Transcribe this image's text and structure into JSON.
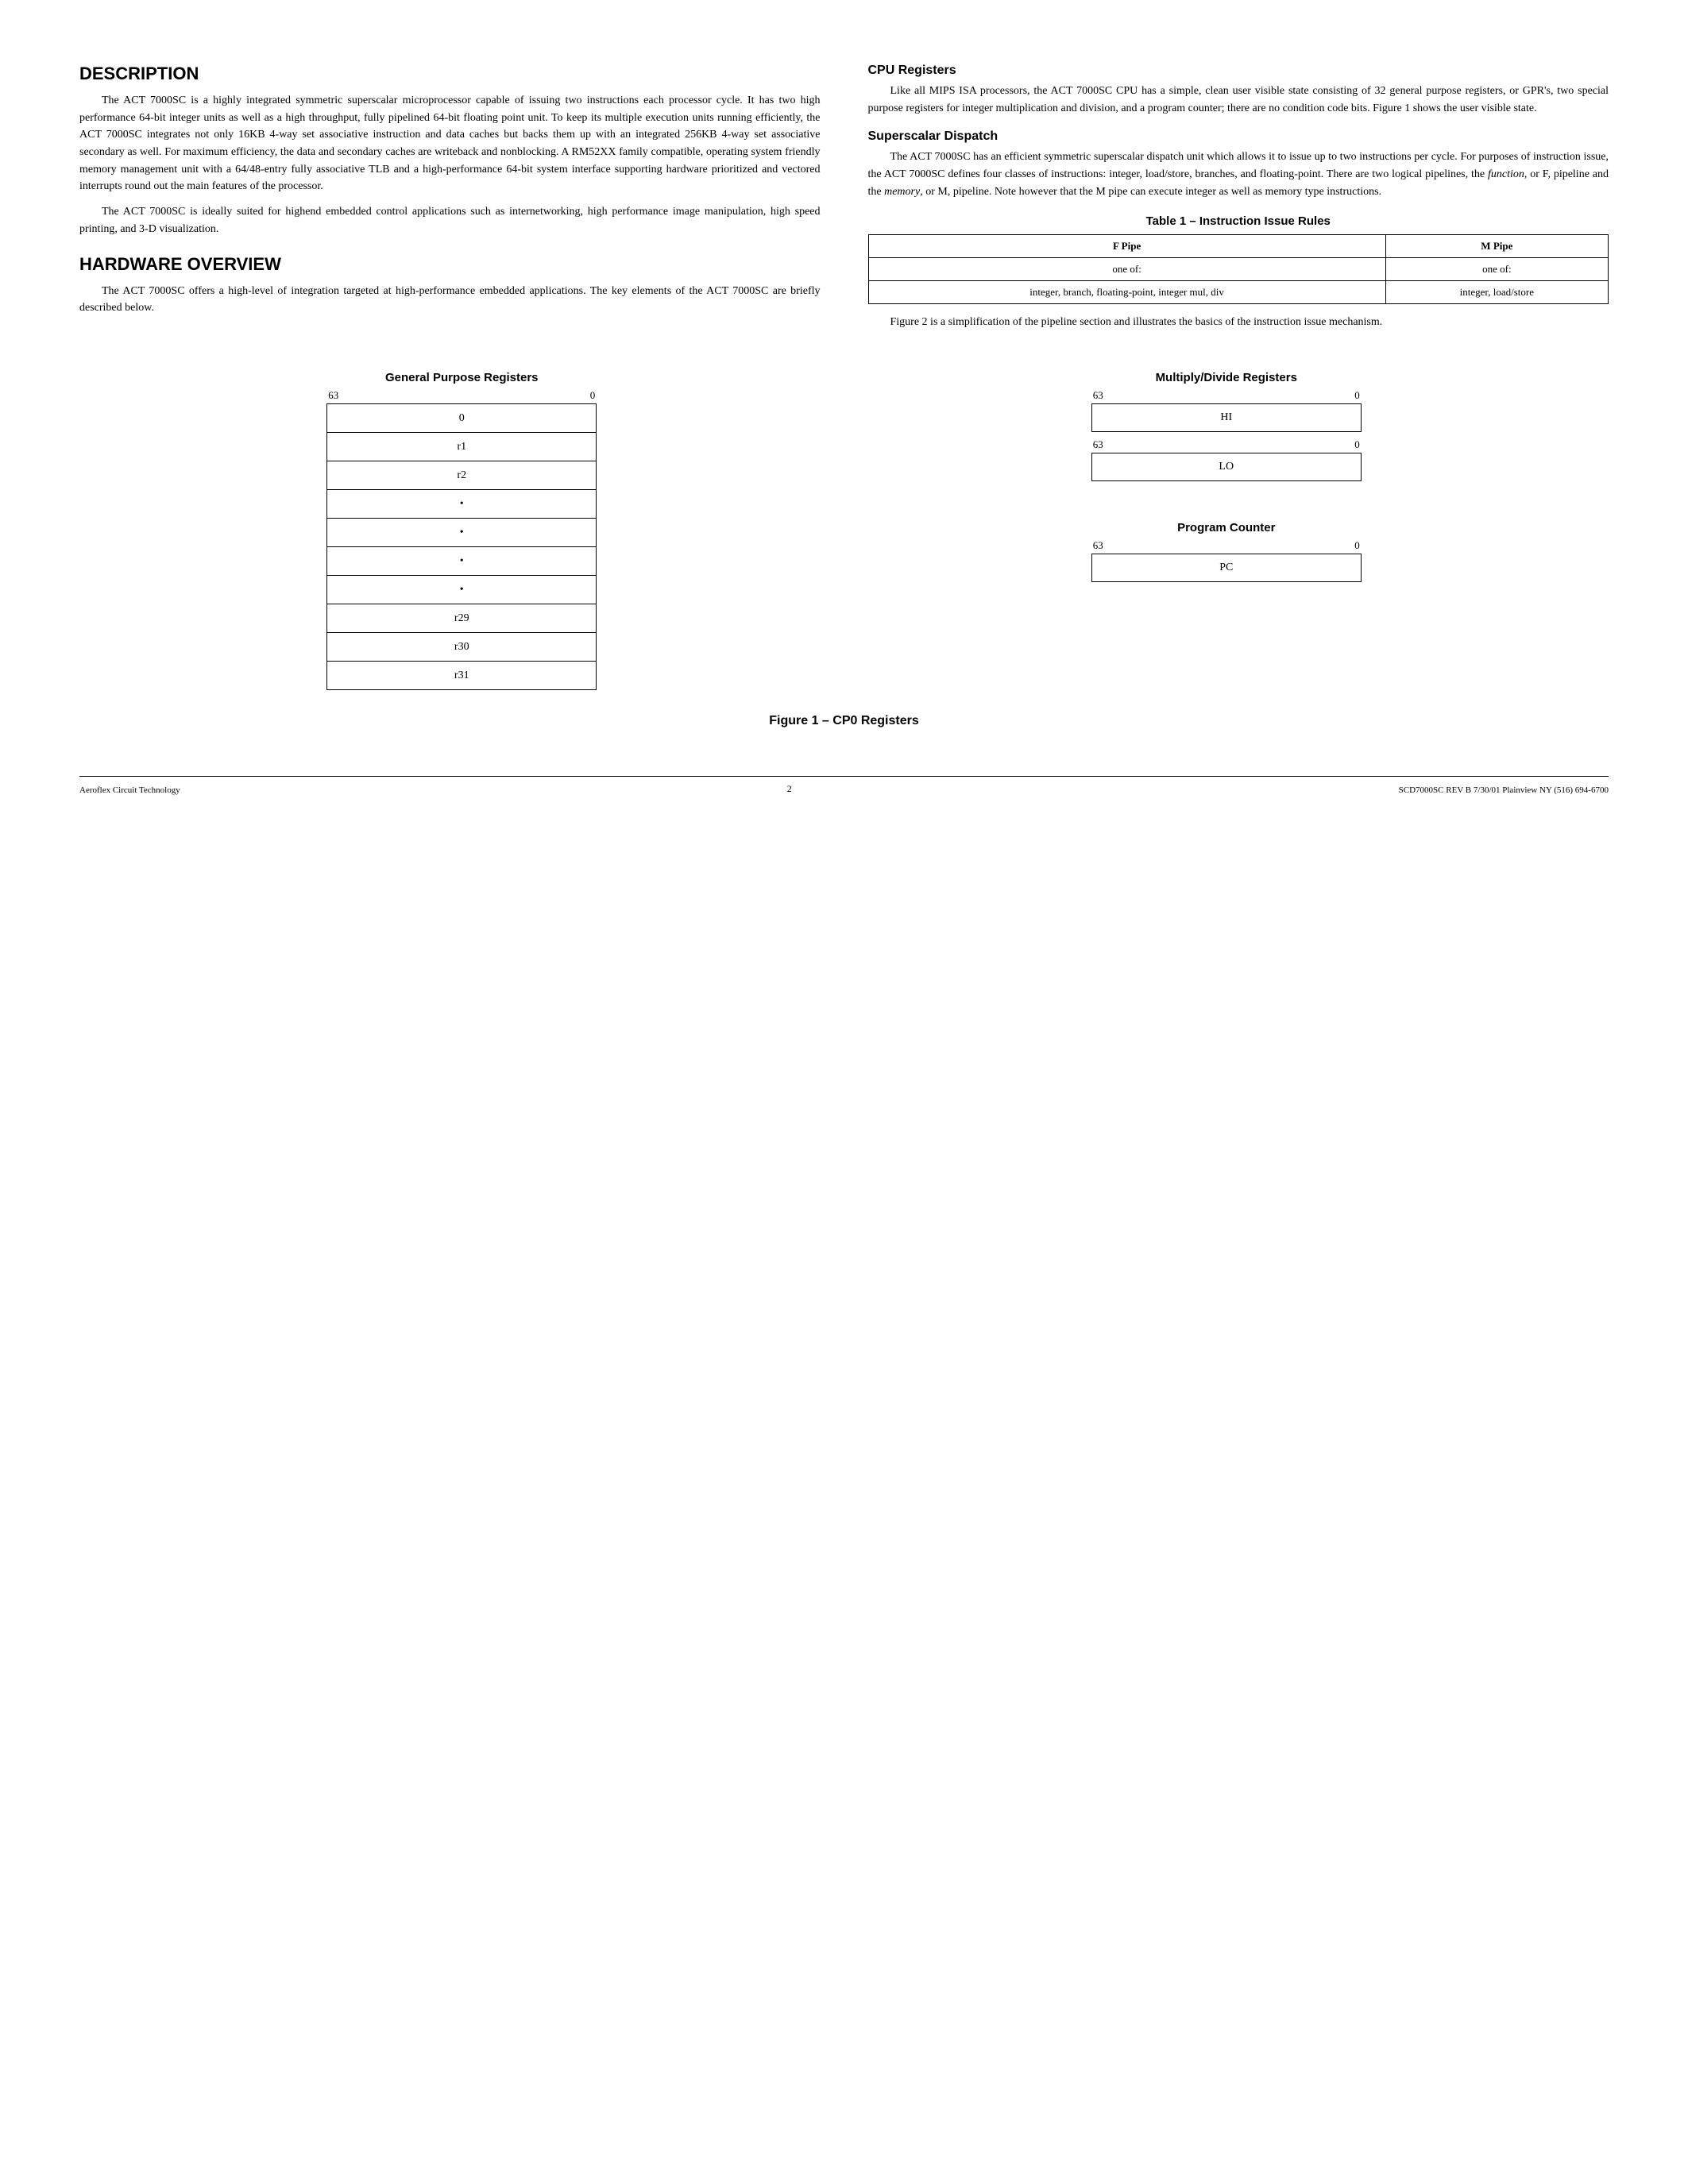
{
  "sections": {
    "description": {
      "title": "DESCRIPTION",
      "paragraphs": [
        "The ACT 7000SC is a highly integrated symmetric superscalar microprocessor capable of issuing two instructions each processor cycle. It has two high performance 64-bit integer units as well as a high throughput, fully pipelined 64-bit floating point unit. To keep its multiple execution units running efficiently, the ACT 7000SC integrates not only 16KB 4-way set associative instruction and data caches but backs them up with an integrated 256KB 4-way set associative secondary as well. For maximum efficiency, the data and secondary caches are writeback and nonblocking. A RM52XX family compatible, operating system friendly memory management unit with a 64/48-entry fully associative TLB and a high-performance 64-bit system interface supporting hardware prioritized and vectored interrupts round out the main features of the processor.",
        "The ACT 7000SC is ideally suited for highend embedded control applications such as internetworking, high performance image manipulation, high speed printing, and 3-D visualization."
      ]
    },
    "hardware_overview": {
      "title": "HARDWARE OVERVIEW",
      "paragraphs": [
        "The ACT 7000SC offers a high-level of integration targeted at high-performance embedded applications. The key elements of the ACT 7000SC are briefly described below."
      ]
    },
    "cpu_registers": {
      "title": "CPU Registers",
      "paragraphs": [
        "Like all MIPS ISA processors, the ACT 7000SC CPU has a simple, clean user visible state consisting of 32 general purpose registers, or GPR's, two special purpose registers for integer multiplication and division, and a program counter; there are no condition code bits. Figure 1 shows the user visible state."
      ]
    },
    "superscalar_dispatch": {
      "title": "Superscalar Dispatch",
      "paragraphs": [
        "The ACT 7000SC has an efficient symmetric superscalar dispatch unit which allows it to issue up to two instructions per cycle. For purposes of instruction issue, the ACT 7000SC defines four classes of instructions: integer, load/store, branches, and floating-point. There are two logical pipelines, the function, or F, pipeline and the memory, or M, pipeline. Note however that the M pipe can execute integer as well as memory type instructions.",
        "Figure 2 is a simplification of the pipeline section and illustrates the basics of the instruction issue mechanism."
      ]
    },
    "table": {
      "title": "Table 1 – Instruction Issue Rules",
      "headers": [
        "F Pipe",
        "M Pipe"
      ],
      "rows": [
        [
          "one of:",
          "one of:"
        ],
        [
          "integer, branch, floating-point, integer mul, div",
          "integer, load/store"
        ]
      ]
    }
  },
  "diagrams": {
    "gpr": {
      "label": "General Purpose Registers",
      "bit_high": "63",
      "bit_low": "0",
      "rows": [
        "0",
        "r1",
        "r2",
        "•",
        "•",
        "•",
        "•",
        "r29",
        "r30",
        "r31"
      ]
    },
    "multiply_divide": {
      "label": "Multiply/Divide Registers",
      "bit_high": "63",
      "bit_low": "0",
      "hi_register": "HI",
      "lo_register": "LO"
    },
    "program_counter": {
      "label": "Program Counter",
      "bit_high": "63",
      "bit_low": "0",
      "register": "PC"
    }
  },
  "figure_caption": "Figure 1 – CP0 Registers",
  "footer": {
    "left": "Aeroflex Circuit Technology",
    "center": "2",
    "right": "SCD7000SC REV B  7/30/01  Plainview NY (516) 694-6700"
  }
}
